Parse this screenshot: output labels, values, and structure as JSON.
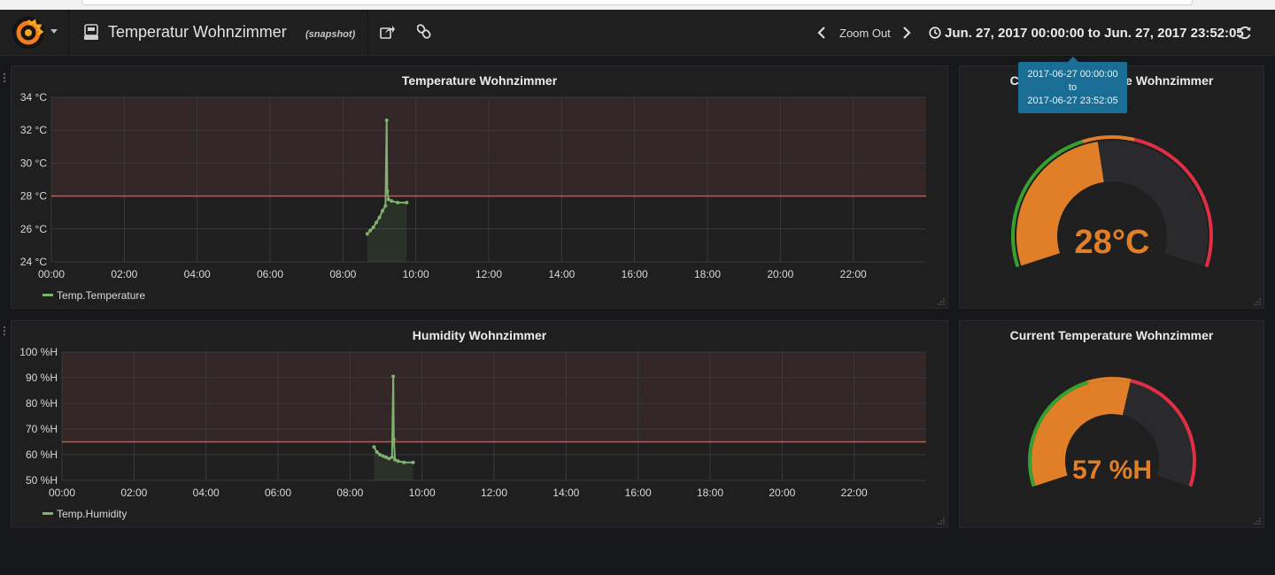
{
  "header": {
    "title": "Temperatur Wohnzimmer",
    "snapshot_label": "(snapshot)",
    "zoom_out_label": "Zoom Out",
    "time_range": "Jun. 27, 2017 00:00:00 to Jun. 27, 2017 23:52:05",
    "icons": [
      "grafana-logo-icon",
      "dashboard-icon",
      "share-icon",
      "link-icon",
      "chevron-left-icon",
      "chevron-right-icon",
      "clock-icon",
      "refresh-icon"
    ]
  },
  "tooltip": {
    "from": "2017-06-27 00:00:00",
    "to_word": "to",
    "to": "2017-06-27 23:52:05"
  },
  "panels": {
    "temp_graph": {
      "title": "Temperature Wohnzimmer",
      "legend": "Temp.Temperature"
    },
    "hum_graph": {
      "title": "Humidity Wohnzimmer",
      "legend": "Temp.Humidity"
    },
    "temp_gauge": {
      "title": "Current Temperature Wohnzimmer",
      "value_text": "28°C",
      "value": 28
    },
    "hum_gauge": {
      "title": "Current Temperature Wohnzimmer",
      "value_text": "57 %H",
      "value": 57
    }
  },
  "colors": {
    "series": "#7eb26d",
    "threshold_line": "#e24d42",
    "gauge_value": "#e17f28",
    "gauge_green": "#37a02e",
    "gauge_orange": "#e17f28",
    "gauge_red": "#e02f44"
  },
  "chart_data": [
    {
      "type": "line",
      "title": "Temperature Wohnzimmer",
      "series": [
        {
          "name": "Temp.Temperature",
          "x": [
            "08:40",
            "08:45",
            "08:50",
            "08:55",
            "09:00",
            "09:05",
            "09:10",
            "09:12",
            "09:13",
            "09:15",
            "09:20",
            "09:30",
            "09:45"
          ],
          "values": [
            25.7,
            25.9,
            26.1,
            26.4,
            26.7,
            27.1,
            27.4,
            32.6,
            28.3,
            27.8,
            27.7,
            27.6,
            27.6
          ]
        }
      ],
      "x_ticks": [
        "00:00",
        "02:00",
        "04:00",
        "06:00",
        "08:00",
        "10:00",
        "12:00",
        "14:00",
        "16:00",
        "18:00",
        "20:00",
        "22:00"
      ],
      "y_ticks": [
        "24 °C",
        "26 °C",
        "28 °C",
        "30 °C",
        "32 °C",
        "34 °C"
      ],
      "ylim": [
        24,
        34
      ],
      "threshold": 28,
      "grid": true,
      "legend": "bottom-left"
    },
    {
      "type": "line",
      "title": "Humidity Wohnzimmer",
      "series": [
        {
          "name": "Temp.Humidity",
          "x": [
            "08:40",
            "08:45",
            "08:50",
            "08:55",
            "09:00",
            "09:05",
            "09:10",
            "09:12",
            "09:13",
            "09:15",
            "09:20",
            "09:30",
            "09:45"
          ],
          "values": [
            63,
            61,
            60,
            59.5,
            59,
            58.5,
            59,
            90.5,
            66,
            58,
            57.5,
            57,
            57
          ]
        }
      ],
      "x_ticks": [
        "00:00",
        "02:00",
        "04:00",
        "06:00",
        "08:00",
        "10:00",
        "12:00",
        "14:00",
        "16:00",
        "18:00",
        "20:00",
        "22:00"
      ],
      "y_ticks": [
        "50 %H",
        "60 %H",
        "70 %H",
        "80 %H",
        "90 %H",
        "100 %H"
      ],
      "ylim": [
        50,
        100
      ],
      "threshold": 65,
      "grid": true,
      "legend": "bottom-left"
    }
  ]
}
